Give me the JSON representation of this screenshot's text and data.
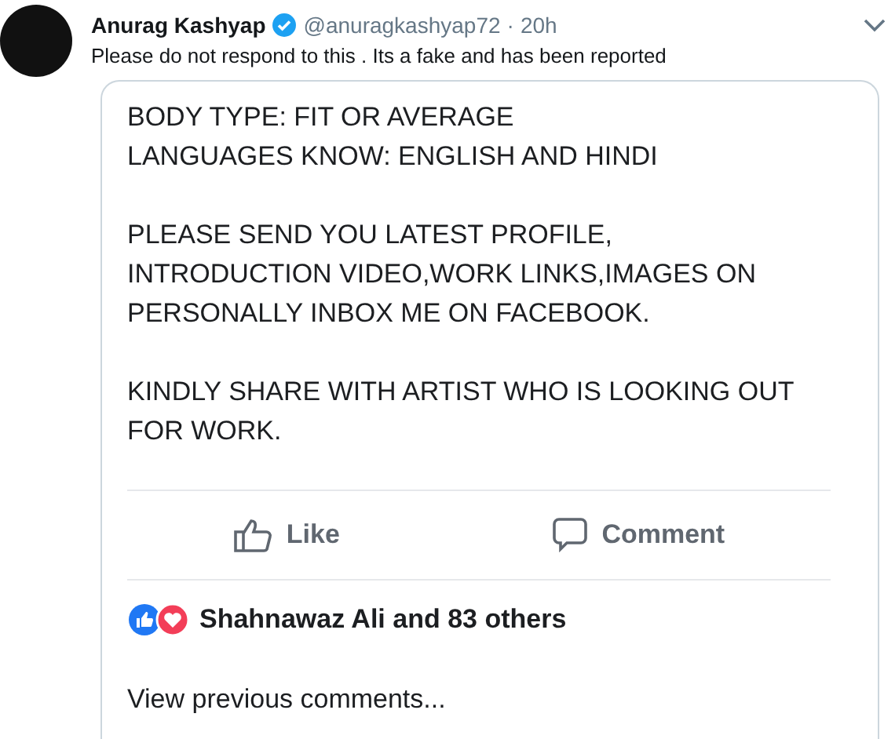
{
  "tweet": {
    "author": "Anurag Kashyap",
    "verified": true,
    "handle": "@anuragkashyap72",
    "separator": "·",
    "time": "20h",
    "text": "Please do not respond to this . Its a fake and has been reported"
  },
  "embedded_post": {
    "paragraphs": [
      [
        "BODY TYPE: FIT OR AVERAGE",
        "LANGUAGES KNOW: ENGLISH AND HINDI"
      ],
      [
        "PLEASE SEND YOU LATEST PROFILE,",
        "INTRODUCTION VIDEO,WORK LINKS,IMAGES ON",
        "PERSONALLY INBOX ME ON FACEBOOK."
      ],
      [
        "KINDLY SHARE WITH ARTIST WHO IS LOOKING OUT",
        "FOR WORK."
      ]
    ],
    "actions": [
      {
        "kind": "like",
        "label": "Like"
      },
      {
        "kind": "comment",
        "label": "Comment"
      }
    ],
    "reactions": "Shahnawaz Ali and 83 others",
    "view_previous": "View previous comments..."
  }
}
